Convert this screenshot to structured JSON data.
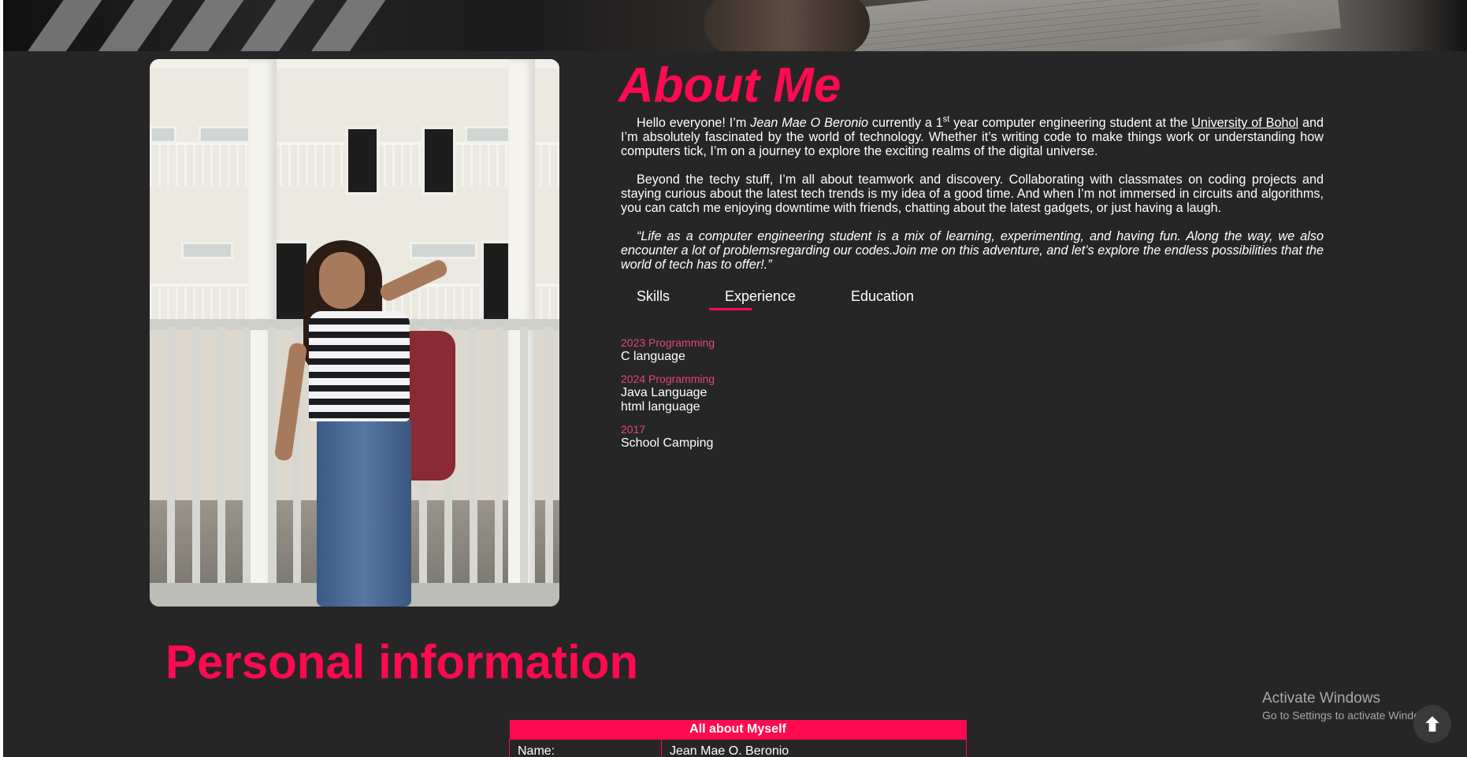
{
  "about": {
    "title": "About Me",
    "p1_a": "Hello everyone! I’m ",
    "p1_name": "Jean Mae O Beronio",
    "p1_b": " currently a 1",
    "p1_sup": "st",
    "p1_c": " year computer engineering student at the ",
    "p1_link": "University of Bohol",
    "p1_d": " and I’m absolutely fascinated by the world of technology. Whether it’s writing code to make things work or understanding how computers tick, I’m on a journey to explore the exciting realms of the digital universe.",
    "p2": "Beyond the techy stuff, I’m all about teamwork and discovery. Collaborating with classmates on coding projects and staying curious about the latest tech trends is my idea of a good time. And when I’m not immersed in circuits and algorithms, you can catch me enjoying downtime with friends, chatting about the latest gadgets, or just having a laugh.",
    "p3": "“Life as a computer engineering student is a mix of learning, experimenting, and having fun. Along the way, we also encounter a lot of problemsregarding our codes.Join me on this adventure, and let’s explore the endless possibilities that the world of tech has to offer!.”"
  },
  "tabs": {
    "skills": "Skills",
    "experience": "Experience",
    "education": "Education",
    "active": "Experience"
  },
  "experience": [
    {
      "year": "2023 Programming",
      "lines": [
        "C language"
      ]
    },
    {
      "year": "2024 Programming",
      "lines": [
        "Java Language",
        "html language"
      ]
    },
    {
      "year": "2017",
      "lines": [
        "School Camping"
      ]
    }
  ],
  "personal": {
    "title": "Personal information",
    "table_header": "All about Myself",
    "rows": [
      {
        "label": "Name:",
        "value": "Jean Mae O. Beronio"
      }
    ]
  },
  "watermark": {
    "line1": "Activate Windows",
    "line2": "Go to Settings to activate Windows."
  },
  "colors": {
    "accent": "#ff0a50",
    "background": "#262626",
    "year_text": "#e0457a"
  },
  "icons": {
    "scroll_top": "arrow-up-icon"
  }
}
